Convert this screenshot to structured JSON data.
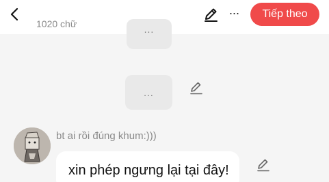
{
  "header": {
    "word_count": "1020 chữ",
    "next_label": "Tiếp theo",
    "more_label": "···",
    "accent_color": "#f04a4a"
  },
  "messages": [
    {
      "text": "..."
    },
    {
      "text": "..."
    },
    {
      "author": "bt ai rồi đúng khum:)))",
      "text": "xin phép ngưng lại tại đây!"
    }
  ]
}
